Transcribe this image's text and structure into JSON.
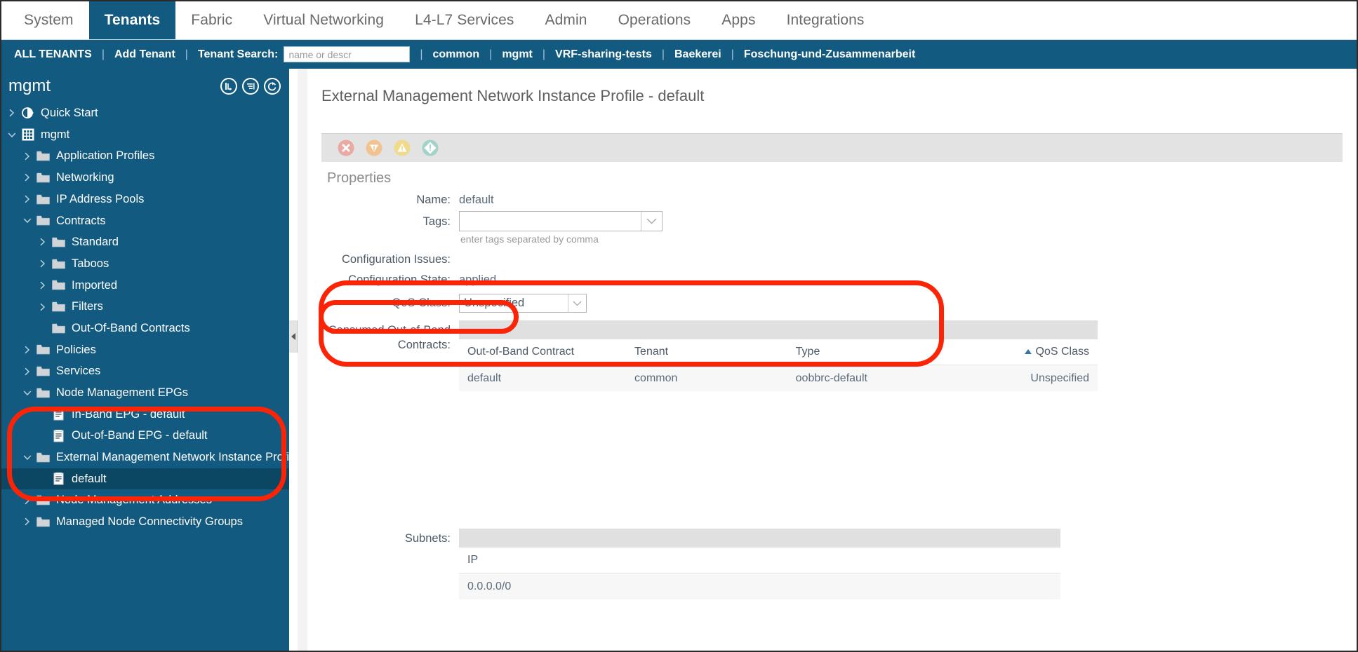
{
  "topnav": {
    "items": [
      {
        "label": "System",
        "active": false
      },
      {
        "label": "Tenants",
        "active": true
      },
      {
        "label": "Fabric",
        "active": false
      },
      {
        "label": "Virtual Networking",
        "active": false
      },
      {
        "label": "L4-L7 Services",
        "active": false
      },
      {
        "label": "Admin",
        "active": false
      },
      {
        "label": "Operations",
        "active": false
      },
      {
        "label": "Apps",
        "active": false
      },
      {
        "label": "Integrations",
        "active": false
      }
    ]
  },
  "tenantbar": {
    "all_tenants": "ALL TENANTS",
    "add_tenant": "Add Tenant",
    "search_label": "Tenant Search:",
    "search_placeholder": "name or descr",
    "search_value": "",
    "separator": "|",
    "tenants": [
      "common",
      "mgmt",
      "VRF-sharing-tests",
      "Baekerei",
      "Foschung-und-Zusammenarbeit"
    ],
    "active_tenant": "mgmt"
  },
  "sidebar": {
    "title": "mgmt",
    "icons": [
      "collapse-all-icon",
      "list-view-icon",
      "refresh-icon"
    ],
    "tree": [
      {
        "label": "Quick Start",
        "depth": 0,
        "twisty": "right",
        "icon": "quickstart-icon",
        "selected": false
      },
      {
        "label": "mgmt",
        "depth": 0,
        "twisty": "down",
        "icon": "tenant-icon",
        "selected": false
      },
      {
        "label": "Application Profiles",
        "depth": 1,
        "twisty": "right",
        "icon": "folder-icon",
        "selected": false
      },
      {
        "label": "Networking",
        "depth": 1,
        "twisty": "right",
        "icon": "folder-icon",
        "selected": false
      },
      {
        "label": "IP Address Pools",
        "depth": 1,
        "twisty": "right",
        "icon": "folder-icon",
        "selected": false
      },
      {
        "label": "Contracts",
        "depth": 1,
        "twisty": "down",
        "icon": "folder-icon",
        "selected": false
      },
      {
        "label": "Standard",
        "depth": 2,
        "twisty": "right",
        "icon": "folder-icon",
        "selected": false
      },
      {
        "label": "Taboos",
        "depth": 2,
        "twisty": "right",
        "icon": "folder-icon",
        "selected": false
      },
      {
        "label": "Imported",
        "depth": 2,
        "twisty": "right",
        "icon": "folder-icon",
        "selected": false
      },
      {
        "label": "Filters",
        "depth": 2,
        "twisty": "right",
        "icon": "folder-icon",
        "selected": false
      },
      {
        "label": "Out-Of-Band Contracts",
        "depth": 2,
        "twisty": "none",
        "icon": "folder-icon",
        "selected": false
      },
      {
        "label": "Policies",
        "depth": 1,
        "twisty": "right",
        "icon": "folder-icon",
        "selected": false
      },
      {
        "label": "Services",
        "depth": 1,
        "twisty": "right",
        "icon": "folder-icon",
        "selected": false
      },
      {
        "label": "Node Management EPGs",
        "depth": 1,
        "twisty": "down",
        "icon": "folder-icon",
        "selected": false
      },
      {
        "label": "In-Band EPG - default",
        "depth": 2,
        "twisty": "none",
        "icon": "epg-icon",
        "selected": false
      },
      {
        "label": "Out-of-Band EPG - default",
        "depth": 2,
        "twisty": "none",
        "icon": "epg-icon",
        "selected": false
      },
      {
        "label": "External Management Network Instance Profiles",
        "depth": 1,
        "twisty": "down",
        "icon": "folder-icon",
        "selected": false
      },
      {
        "label": "default",
        "depth": 2,
        "twisty": "none",
        "icon": "epg-icon",
        "selected": true
      },
      {
        "label": "Node Management Addresses",
        "depth": 1,
        "twisty": "right",
        "icon": "folder-icon",
        "selected": false
      },
      {
        "label": "Managed Node Connectivity Groups",
        "depth": 1,
        "twisty": "right",
        "icon": "folder-icon",
        "selected": false
      }
    ]
  },
  "main": {
    "page_title": "External Management Network Instance Profile - default",
    "fault_icons": [
      {
        "name": "fault-critical-icon",
        "color": "#e8a7a0"
      },
      {
        "name": "fault-major-icon",
        "color": "#f2c08f"
      },
      {
        "name": "fault-minor-icon",
        "color": "#efd98a"
      },
      {
        "name": "fault-warning-icon",
        "color": "#9fd0c6"
      }
    ],
    "properties_heading": "Properties",
    "fields": {
      "name_label": "Name:",
      "name_value": "default",
      "tags_label": "Tags:",
      "tags_value": "",
      "tags_hint": "enter tags separated by comma",
      "config_issues_label": "Configuration Issues:",
      "config_issues_value": "",
      "config_state_label": "Configuration State:",
      "config_state_value": "applied",
      "qos_class_label": "QoS Class:",
      "qos_class_value": "Unspecified",
      "consumed_label_line1": "Consumed Out-of-Band",
      "consumed_label_line2": "Contracts:",
      "subnets_label": "Subnets:"
    },
    "consumed_table": {
      "columns": [
        "Out-of-Band Contract",
        "Tenant",
        "Type",
        "QoS Class"
      ],
      "sorted_column": "QoS Class",
      "rows": [
        {
          "contract": "default",
          "tenant": "common",
          "type": "oobbrc-default",
          "qos_class": "Unspecified"
        }
      ]
    },
    "subnets_table": {
      "columns": [
        "IP"
      ],
      "rows": [
        {
          "ip": "0.0.0.0/0"
        }
      ]
    }
  },
  "annotations": {
    "accent_color": "#fb2407",
    "shapes": [
      "oob-contracts-oval",
      "tree-section-oval",
      "consumed-contracts-oval"
    ]
  }
}
